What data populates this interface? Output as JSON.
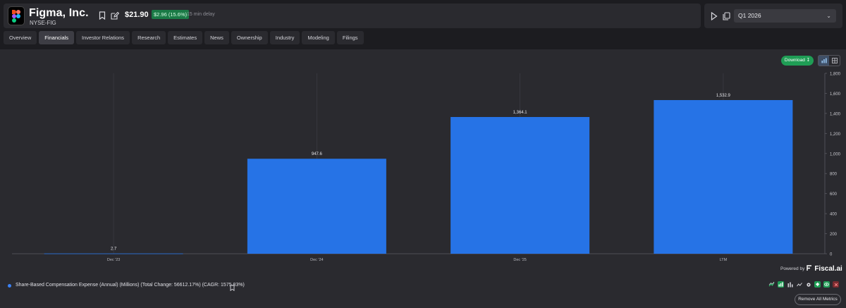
{
  "company": {
    "name": "Figma, Inc.",
    "ticker": "NYSE-FIG",
    "price": "$21.90",
    "change": "$2.96 (15.6%)",
    "delay": "15 min delay"
  },
  "period": {
    "selected": "Q1 2026"
  },
  "tabs": [
    {
      "label": "Overview"
    },
    {
      "label": "Financials",
      "active": true
    },
    {
      "label": "Investor Relations"
    },
    {
      "label": "Research"
    },
    {
      "label": "Estimates"
    },
    {
      "label": "News"
    },
    {
      "label": "Ownership"
    },
    {
      "label": "Industry"
    },
    {
      "label": "Modeling"
    },
    {
      "label": "Filings"
    }
  ],
  "toolbar": {
    "download_label": "Download"
  },
  "chart_data": {
    "type": "bar",
    "categories": [
      "Dec '23",
      "Dec '24",
      "Dec '25",
      "LTM"
    ],
    "values": [
      2.7,
      947.6,
      1364.1,
      1532.9
    ],
    "value_labels": [
      "2.7",
      "947.6",
      "1,364.1",
      "1,532.9"
    ],
    "ylim": [
      0,
      1800
    ],
    "yticks": [
      "0",
      "200",
      "400",
      "600",
      "800",
      "1,000",
      "1,200",
      "1,400",
      "1,600",
      "1,800"
    ],
    "y_axis_side": "right",
    "grid": "vertical",
    "bar_color": "#2673e6",
    "title": "",
    "xlabel": "",
    "ylabel": ""
  },
  "footer": {
    "powered_by": "Powered by",
    "brand": "Fiscal.ai",
    "series_label": "Share-Based Compensation Expense (Annual) (Millions) (Total Change: 56612.17%) (CAGR: 1575.83%)",
    "series_color": "#3b82f6",
    "remove_all_label": "Remove All Metrics"
  }
}
